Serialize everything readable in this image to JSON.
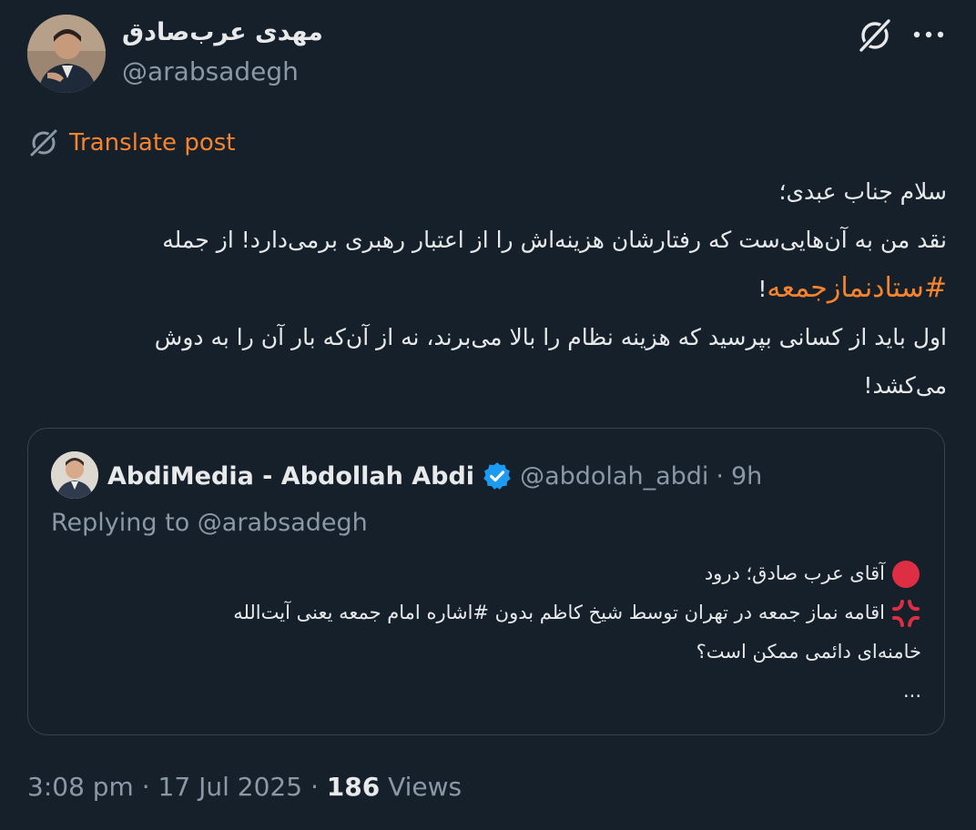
{
  "author": {
    "name": "مهدی عرب‌صادق",
    "handle": "@arabsadegh"
  },
  "icons": {
    "grok": "grok-icon",
    "more": "more-icon",
    "translate": "grok-translate-icon",
    "verified": "verified-badge-icon",
    "red_circle": "red-circle-emoji",
    "anger": "anger-symbol-emoji"
  },
  "translate_label": "Translate post",
  "post": {
    "line1": "سلام جناب عبدی؛",
    "line2": "نقد من به آن‌هایی‌ست که رفتارشان هزینه‌اش را از اعتبار رهبری برمی‌دارد! از جمله",
    "hashtag": "#ستادنمازجمعه",
    "hashtag_suffix": "!",
    "line4": "اول باید از کسانی بپرسید که هزینه نظام را بالا می‌برند، نه از آن‌که بار آن را به دوش",
    "line5": "می‌کشد!"
  },
  "quote": {
    "name": "AbdiMedia - Abdollah Abdi",
    "handle": "@abdolah_abdi",
    "separator": "·",
    "time": "9h",
    "replying": "Replying to @arabsadegh",
    "line1": "آقای عرب صادق؛ درود",
    "line2": "اقامه نماز جمعه در تهران توسط شیخ کاظم بدون #اشاره امام جمعه یعنی آیت‌الله",
    "line3": "خامنه‌ای دائمی ممکن است؟",
    "ellipsis": "..."
  },
  "footer": {
    "time": "3:08 pm",
    "sep1": "·",
    "date": "17 Jul 2025",
    "sep2": "·",
    "views_count": "186",
    "views_label": "Views"
  },
  "colors": {
    "background": "#15202b",
    "text": "#e7e9ea",
    "muted": "#8b98a5",
    "accent": "#f7842d",
    "border": "#38444d",
    "verified": "#1d9bf0"
  }
}
